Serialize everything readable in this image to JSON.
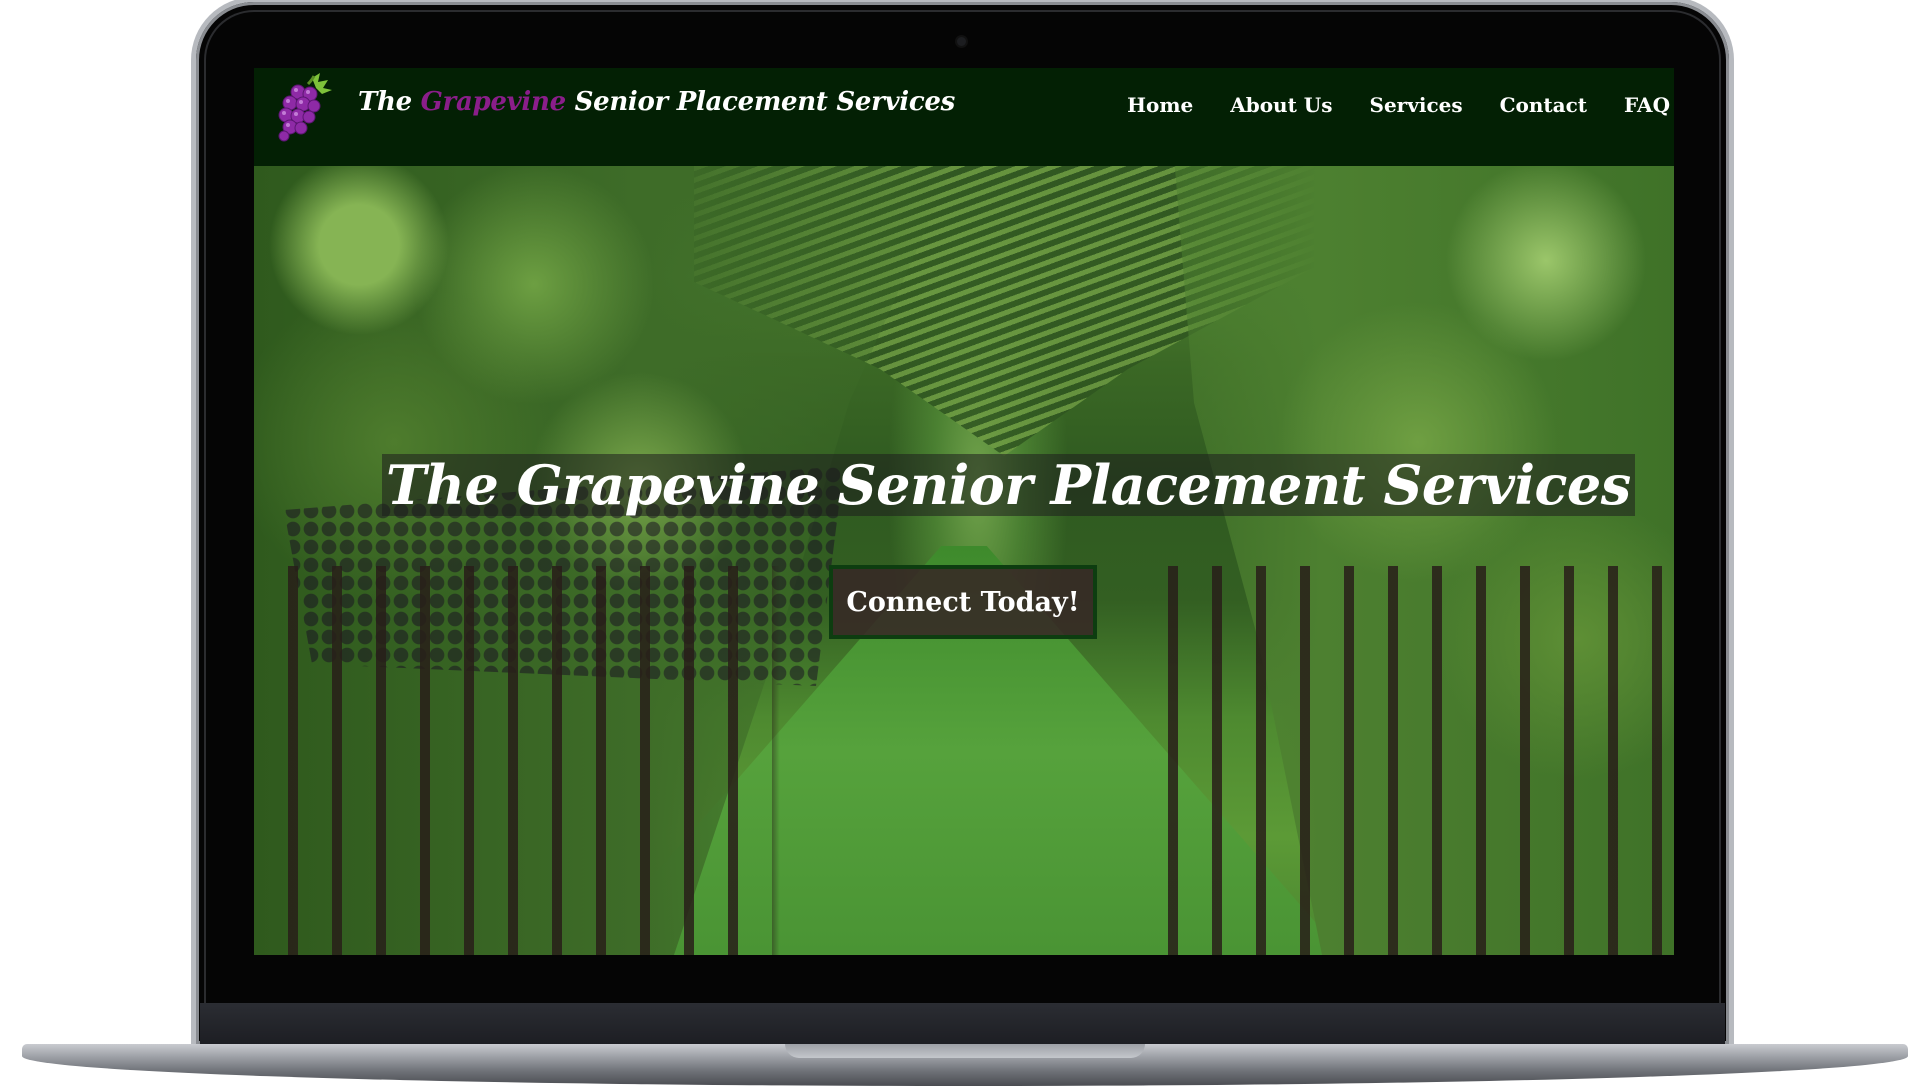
{
  "header": {
    "brand_prefix": "The ",
    "brand_accent": "Grapevine",
    "brand_suffix": " Senior Placement Services",
    "logo_icon": "grapes-icon"
  },
  "nav": {
    "items": [
      {
        "label": "Home"
      },
      {
        "label": "About Us"
      },
      {
        "label": "Services"
      },
      {
        "label": "Contact"
      },
      {
        "label": "FAQ"
      }
    ]
  },
  "hero": {
    "title": "The Grapevine Senior Placement Services",
    "cta_label": "Connect Today!"
  },
  "colors": {
    "navbar_bg": "#032004",
    "brand_accent": "#8a1e8a",
    "cta_border": "#0d3d10"
  }
}
